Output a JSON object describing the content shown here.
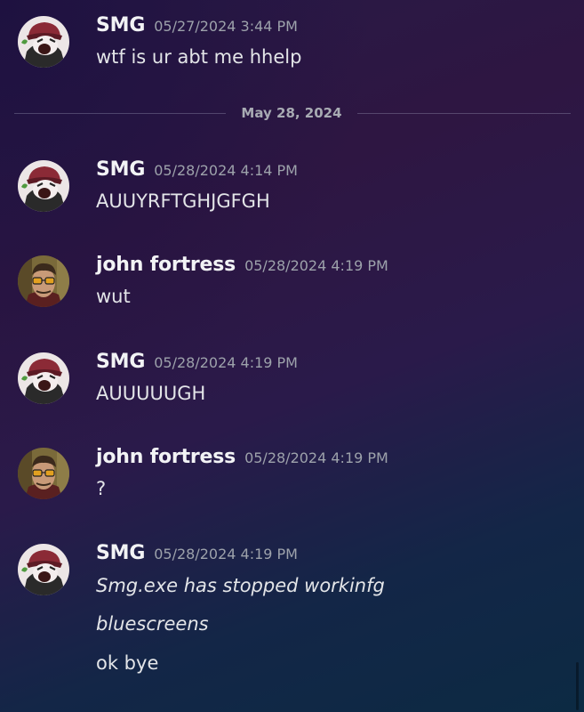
{
  "messages": [
    {
      "username": "SMG",
      "timestamp": "05/27/2024 3:44 PM",
      "avatar": "smg-avatar",
      "lines": [
        "wtf is ur abt me hhelp"
      ]
    },
    {
      "username": "SMG",
      "timestamp": "05/28/2024 4:14 PM",
      "avatar": "smg-avatar",
      "lines": [
        "AUUYRFTGHJGFGH"
      ]
    },
    {
      "username": "john fortress",
      "timestamp": "05/28/2024 4:19 PM",
      "avatar": "john-fortress-avatar",
      "lines": [
        "wut"
      ]
    },
    {
      "username": "SMG",
      "timestamp": "05/28/2024 4:19 PM",
      "avatar": "smg-avatar",
      "lines": [
        "AUUUUUGH"
      ]
    },
    {
      "username": "john fortress",
      "timestamp": "05/28/2024 4:19 PM",
      "avatar": "john-fortress-avatar",
      "lines": [
        "?"
      ]
    },
    {
      "username": "SMG",
      "timestamp": "05/28/2024 4:19 PM",
      "avatar": "smg-avatar",
      "lines": [
        "Smg.exe has stopped workinfg",
        "bluescreens",
        "ok bye"
      ]
    }
  ],
  "date_divider": "May 28, 2024",
  "colors": {
    "username": "#f2f3f5",
    "timestamp": "#9da2ab",
    "message_text": "#e3e5e8",
    "divider_date": "#a8abb3"
  }
}
